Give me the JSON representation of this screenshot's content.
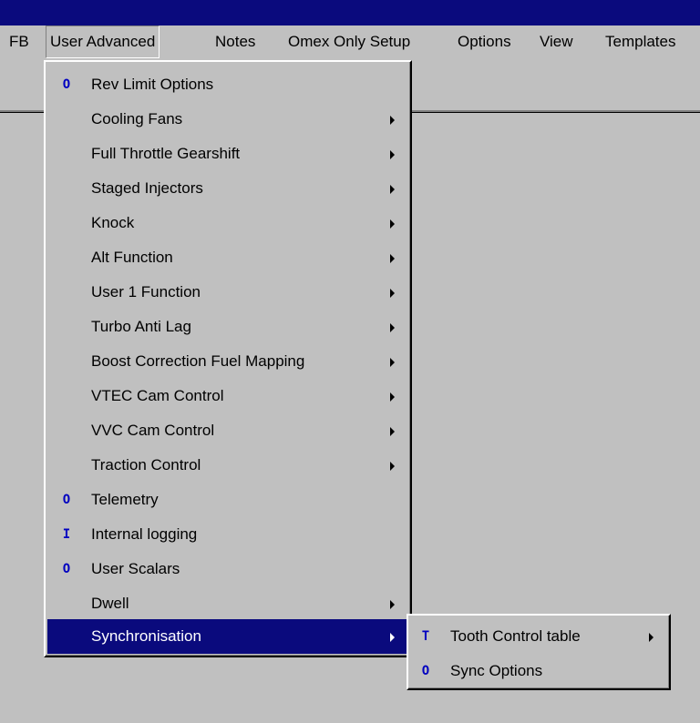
{
  "menubar": {
    "items": [
      {
        "label": "FB"
      },
      {
        "label": "User Advanced"
      },
      {
        "label": "Notes"
      },
      {
        "label": "Omex Only Setup"
      },
      {
        "label": "Options"
      },
      {
        "label": "View"
      },
      {
        "label": "Templates"
      }
    ]
  },
  "user_advanced_menu": {
    "items": [
      {
        "label": "Rev Limit Options",
        "badge": "O",
        "submenu": false
      },
      {
        "label": "Cooling Fans",
        "badge": "",
        "submenu": true
      },
      {
        "label": "Full Throttle Gearshift",
        "badge": "",
        "submenu": true
      },
      {
        "label": "Staged Injectors",
        "badge": "",
        "submenu": true
      },
      {
        "label": "Knock",
        "badge": "",
        "submenu": true
      },
      {
        "label": "Alt Function",
        "badge": "",
        "submenu": true
      },
      {
        "label": "User 1 Function",
        "badge": "",
        "submenu": true
      },
      {
        "label": "Turbo Anti Lag",
        "badge": "",
        "submenu": true
      },
      {
        "label": "Boost Correction Fuel Mapping",
        "badge": "",
        "submenu": true
      },
      {
        "label": "VTEC Cam Control",
        "badge": "",
        "submenu": true
      },
      {
        "label": "VVC Cam Control",
        "badge": "",
        "submenu": true
      },
      {
        "label": "Traction Control",
        "badge": "",
        "submenu": true
      },
      {
        "label": "Telemetry",
        "badge": "O",
        "submenu": false
      },
      {
        "label": "Internal logging",
        "badge": "I",
        "submenu": false
      },
      {
        "label": "User Scalars",
        "badge": "O",
        "submenu": false
      },
      {
        "label": "Dwell",
        "badge": "",
        "submenu": true
      },
      {
        "label": "Synchronisation",
        "badge": "",
        "submenu": true
      }
    ]
  },
  "synchronisation_submenu": {
    "items": [
      {
        "label": "Tooth Control table",
        "badge": "T",
        "submenu": true
      },
      {
        "label": "Sync Options",
        "badge": "O",
        "submenu": false
      }
    ]
  },
  "colors": {
    "highlight": "#0a0a7d",
    "badge": "#0000c0",
    "face": "#c0c0c0"
  }
}
